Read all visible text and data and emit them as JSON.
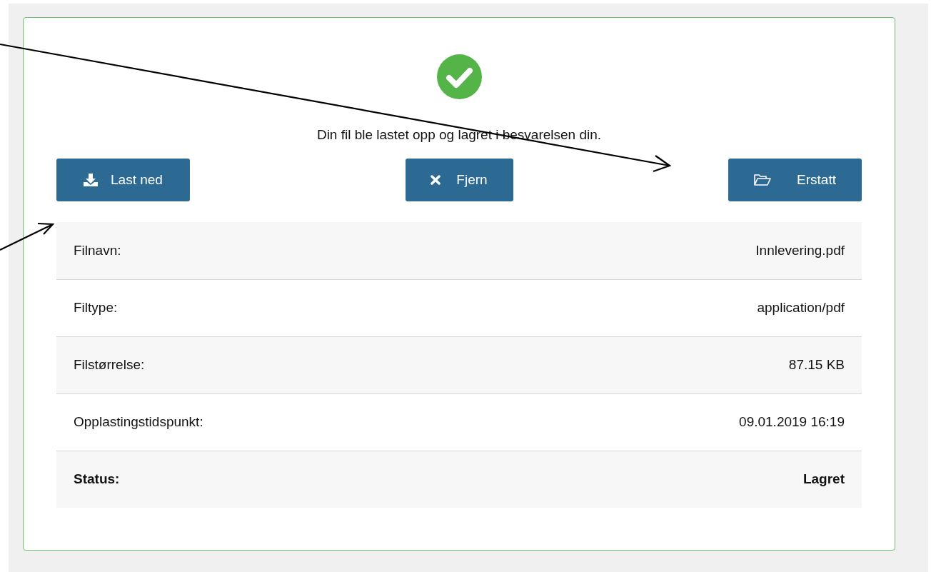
{
  "message": "Din fil ble lastet opp og lagret i besvarelsen din.",
  "buttons": [
    {
      "label": "Last ned",
      "kind": "download"
    },
    {
      "label": "Fjern",
      "kind": "remove"
    },
    {
      "label": "Erstatt",
      "kind": "replace"
    }
  ],
  "details": [
    {
      "label": "Filnavn:",
      "value": "Innlevering.pdf",
      "emphasis": false
    },
    {
      "label": "Filtype:",
      "value": "application/pdf",
      "emphasis": false
    },
    {
      "label": "Filstørrelse:",
      "value": "87.15 KB",
      "emphasis": false
    },
    {
      "label": "Opplastingstidspunkt:",
      "value": "09.01.2019 16:19",
      "emphasis": false
    },
    {
      "label": "Status:",
      "value": "Lagret",
      "emphasis": true
    }
  ]
}
